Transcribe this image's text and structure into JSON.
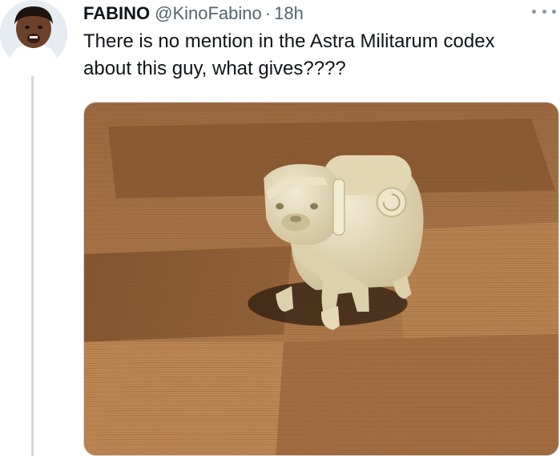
{
  "tweet": {
    "author_name": "FABINO",
    "handle": "@KinoFabino",
    "separator": "·",
    "timestamp": "18h",
    "text": "There is no mention in the Astra Militarum codex about this guy, what gives????",
    "avatar_icon": "user-avatar",
    "more_icon": "more-options-icon"
  },
  "colors": {
    "text_primary": "#0f1419",
    "text_secondary": "#536471",
    "thread_line": "#cfd9de",
    "wood": "#a8764a",
    "figure": "#e6dcc0"
  }
}
